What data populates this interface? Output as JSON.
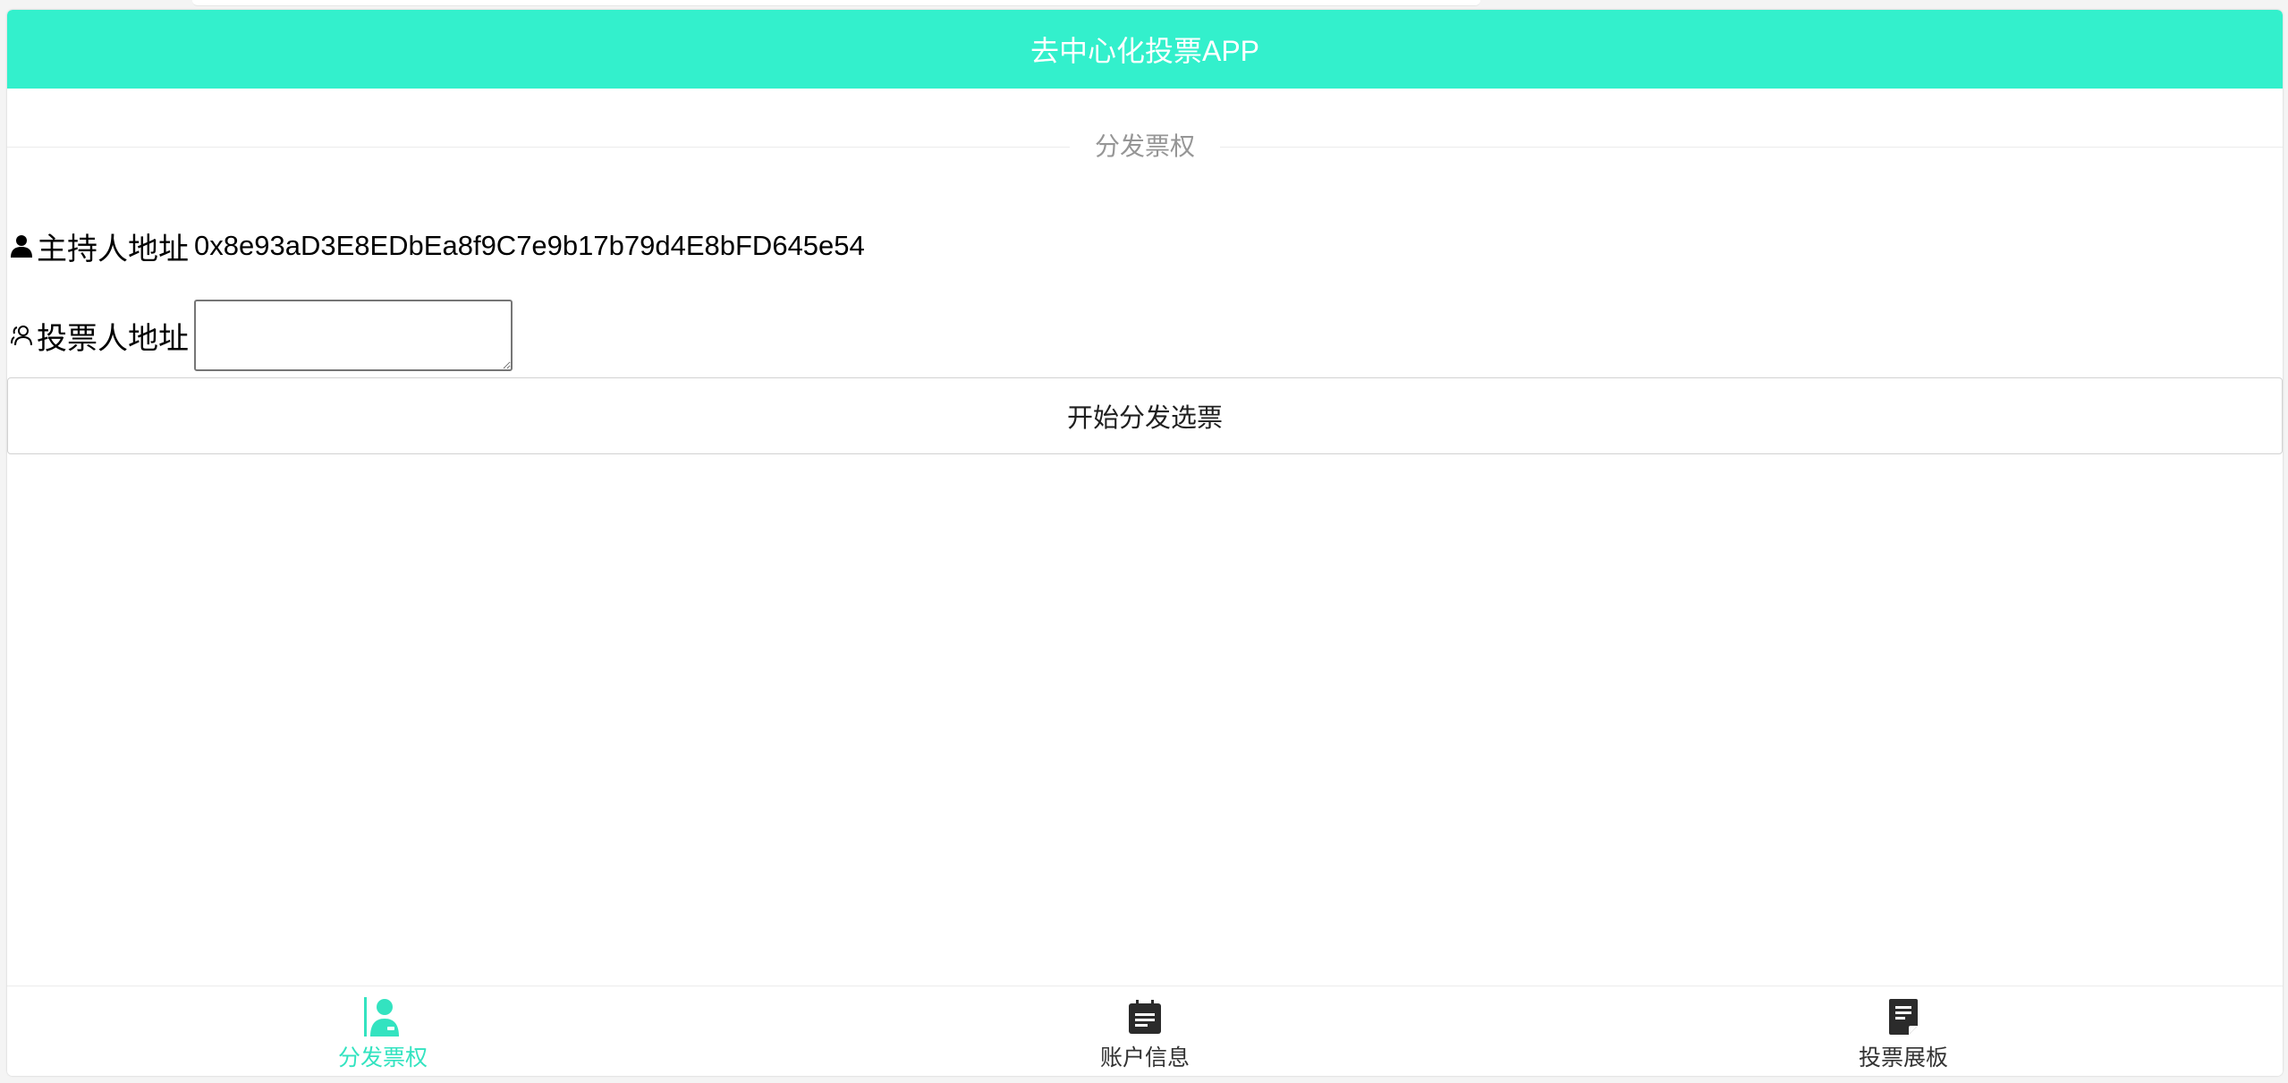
{
  "header": {
    "title": "去中心化投票APP"
  },
  "section": {
    "title": "分发票权"
  },
  "form": {
    "host_label": "主持人地址",
    "host_address": "0x8e93aD3E8EDbEa8f9C7e9b17b79d4E8bFD645e54",
    "voter_label": "投票人地址",
    "voter_value": "",
    "submit_label": "开始分发选票"
  },
  "tabbar": {
    "items": [
      {
        "label": "分发票权",
        "icon": "user-badge-icon",
        "active": true
      },
      {
        "label": "账户信息",
        "icon": "calendar-note-icon",
        "active": false
      },
      {
        "label": "投票展板",
        "icon": "document-icon",
        "active": false
      }
    ]
  },
  "colors": {
    "accent": "#33f0cc",
    "active_tab": "#33e3c0",
    "muted_text": "#969696"
  }
}
